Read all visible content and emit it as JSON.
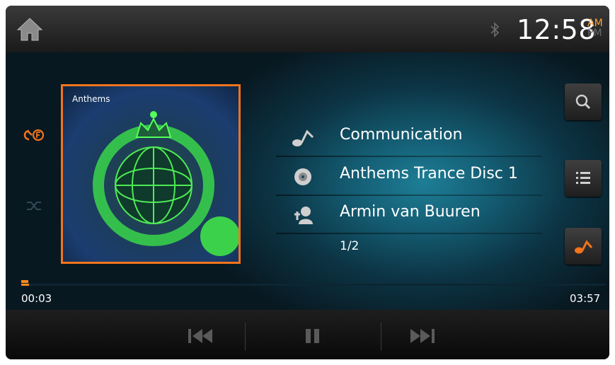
{
  "status_bar": {
    "time": "12:58",
    "am": "AM",
    "pm": "PM",
    "icons": [
      "home-icon",
      "bluetooth-icon"
    ]
  },
  "album": {
    "cover_text": "Anthems"
  },
  "track_info": {
    "title": "Communication",
    "album": "Anthems Trance Disc 1",
    "artist": "Armin van Buuren",
    "track_number": "1/2"
  },
  "playback": {
    "elapsed": "00:03",
    "duration": "03:57",
    "progress_fraction": 0.013
  },
  "left_controls": [
    "repeat-folder-icon",
    "shuffle-icon"
  ],
  "right_controls": [
    "search-icon",
    "playlist-icon",
    "eq-icon"
  ],
  "transport_controls": [
    "previous-icon",
    "pause-icon",
    "next-icon"
  ],
  "colors": {
    "accent": "#f3741d",
    "background": "#0c3444"
  }
}
